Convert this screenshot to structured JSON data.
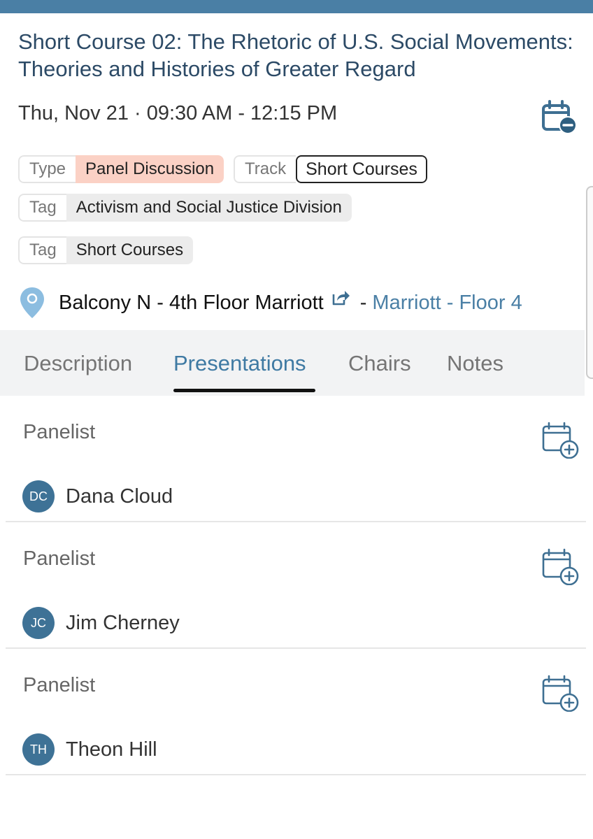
{
  "session": {
    "title": "Short Course 02: The Rhetoric of U.S. Social Movements: Theories and Histories of Greater Regard",
    "datetime": "Thu, Nov 21 · 09:30 AM - 12:15 PM"
  },
  "chips": {
    "type_key": "Type",
    "type_value": "Panel Discussion",
    "track_key": "Track",
    "track_value": "Short Courses",
    "tag1_key": "Tag",
    "tag1_value": "Activism and Social Justice Division",
    "tag2_key": "Tag",
    "tag2_value": "Short Courses"
  },
  "location": {
    "room": "Balcony N - 4th Floor Marriott",
    "separator": "-",
    "venue_link": "Marriott - Floor 4"
  },
  "tabs": [
    {
      "label": "Description"
    },
    {
      "label": "Presentations"
    },
    {
      "label": "Chairs"
    },
    {
      "label": "Notes"
    }
  ],
  "active_tab": "Presentations",
  "presentations": [
    {
      "role": "Panelist",
      "initials": "DC",
      "name": "Dana Cloud"
    },
    {
      "role": "Panelist",
      "initials": "JC",
      "name": "Jim Cherney"
    },
    {
      "role": "Panelist",
      "initials": "TH",
      "name": "Theon Hill"
    }
  ],
  "colors": {
    "accent": "#4a7fa5",
    "type_chip": "#fbd1c5",
    "avatar": "#3e7296"
  },
  "icons": {
    "calendar_remove": "calendar-remove-icon",
    "calendar_add": "calendar-add-icon",
    "location_pin": "location-pin-icon",
    "external_link": "external-link-icon"
  }
}
